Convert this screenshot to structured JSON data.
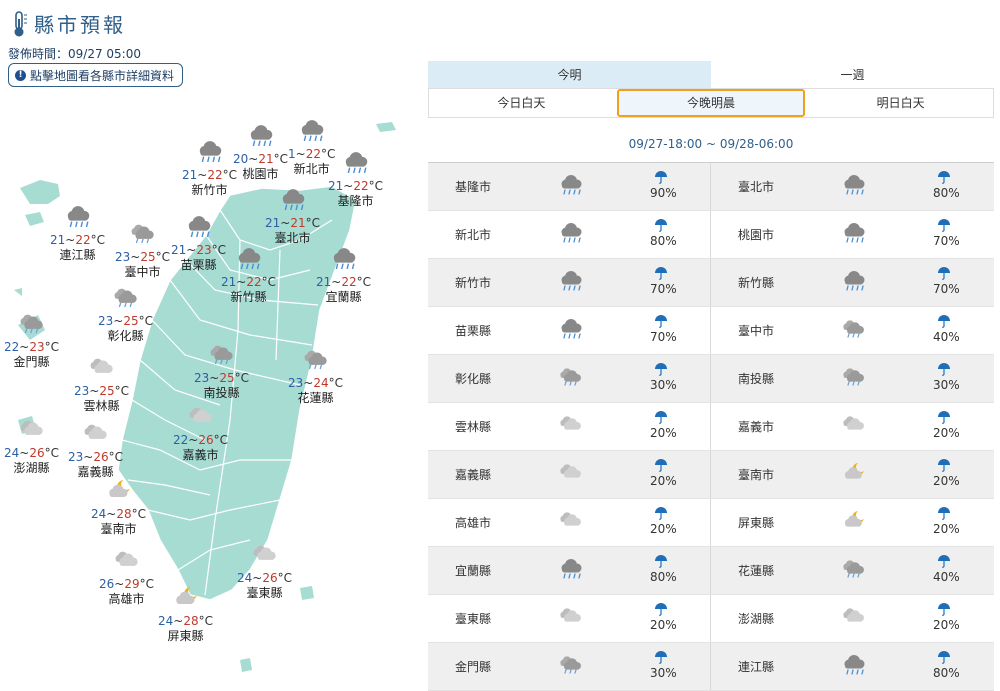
{
  "header": {
    "title": "縣市預報",
    "issue_time": "發佈時間：09/27 05:00",
    "hint_button": "點擊地圖看各縣市詳細資料",
    "hint_icon": "info-icon"
  },
  "tabs": {
    "primary": [
      "今明",
      "一週"
    ],
    "secondary": [
      "今日白天",
      "今晚明晨",
      "明日白天"
    ],
    "active_secondary": "今晚明晨"
  },
  "period": "09/27-18:00 ~ 09/28-06:00",
  "colors": {
    "title": "#2f5f8a",
    "low_temp": "#2b5fa6",
    "high_temp": "#c0392b",
    "map_land": "#a7dcd3",
    "active_tab_border": "#f0a020",
    "umbrella": "#1e6fb8"
  },
  "map_cities": [
    {
      "name": "新竹市",
      "lo": "21",
      "hi": "22",
      "icon": "rain"
    },
    {
      "name": "桃園市",
      "lo": "20",
      "hi": "21",
      "icon": "rain"
    },
    {
      "name": "新北市",
      "lo": "1",
      "hi": "22",
      "icon": "rain"
    },
    {
      "name": "基隆市",
      "lo": "21",
      "hi": "22",
      "icon": "rain"
    },
    {
      "name": "連江縣",
      "lo": "21",
      "hi": "22",
      "icon": "rain"
    },
    {
      "name": "臺中市",
      "lo": "23",
      "hi": "25",
      "icon": "cloudy-rain"
    },
    {
      "name": "苗栗縣",
      "lo": "21",
      "hi": "23",
      "icon": "rain"
    },
    {
      "name": "臺北市",
      "lo": "21",
      "hi": "21",
      "icon": "rain"
    },
    {
      "name": "新竹縣",
      "lo": "21",
      "hi": "22",
      "icon": "rain"
    },
    {
      "name": "宜蘭縣",
      "lo": "21",
      "hi": "22",
      "icon": "rain"
    },
    {
      "name": "彰化縣",
      "lo": "23",
      "hi": "25",
      "icon": "cloudy-rain"
    },
    {
      "name": "金門縣",
      "lo": "22",
      "hi": "23",
      "icon": "cloudy-rain"
    },
    {
      "name": "南投縣",
      "lo": "23",
      "hi": "25",
      "icon": "cloudy-rain"
    },
    {
      "name": "花蓮縣",
      "lo": "23",
      "hi": "24",
      "icon": "cloudy-rain"
    },
    {
      "name": "雲林縣",
      "lo": "23",
      "hi": "25",
      "icon": "cloudy"
    },
    {
      "name": "澎湖縣",
      "lo": "24",
      "hi": "26",
      "icon": "cloudy"
    },
    {
      "name": "嘉義市",
      "lo": "22",
      "hi": "26",
      "icon": "cloudy"
    },
    {
      "name": "嘉義縣",
      "lo": "23",
      "hi": "26",
      "icon": "cloudy"
    },
    {
      "name": "臺南市",
      "lo": "24",
      "hi": "28",
      "icon": "partly-cloudy-night"
    },
    {
      "name": "高雄市",
      "lo": "26",
      "hi": "29",
      "icon": "cloudy"
    },
    {
      "name": "臺東縣",
      "lo": "24",
      "hi": "26",
      "icon": "cloudy"
    },
    {
      "name": "屏東縣",
      "lo": "24",
      "hi": "28",
      "icon": "partly-cloudy-night"
    }
  ],
  "forecast_rows": [
    [
      {
        "name": "基隆市",
        "icon": "rain",
        "pop": "90%"
      },
      {
        "name": "臺北市",
        "icon": "rain",
        "pop": "80%"
      }
    ],
    [
      {
        "name": "新北市",
        "icon": "rain",
        "pop": "80%"
      },
      {
        "name": "桃園市",
        "icon": "rain",
        "pop": "70%"
      }
    ],
    [
      {
        "name": "新竹市",
        "icon": "rain",
        "pop": "70%"
      },
      {
        "name": "新竹縣",
        "icon": "rain",
        "pop": "70%"
      }
    ],
    [
      {
        "name": "苗栗縣",
        "icon": "rain",
        "pop": "70%"
      },
      {
        "name": "臺中市",
        "icon": "cloudy-rain",
        "pop": "40%"
      }
    ],
    [
      {
        "name": "彰化縣",
        "icon": "cloudy-rain",
        "pop": "30%"
      },
      {
        "name": "南投縣",
        "icon": "cloudy-rain",
        "pop": "30%"
      }
    ],
    [
      {
        "name": "雲林縣",
        "icon": "cloudy",
        "pop": "20%"
      },
      {
        "name": "嘉義市",
        "icon": "cloudy",
        "pop": "20%"
      }
    ],
    [
      {
        "name": "嘉義縣",
        "icon": "cloudy",
        "pop": "20%"
      },
      {
        "name": "臺南市",
        "icon": "partly-cloudy-night",
        "pop": "20%"
      }
    ],
    [
      {
        "name": "高雄市",
        "icon": "cloudy",
        "pop": "20%"
      },
      {
        "name": "屏東縣",
        "icon": "partly-cloudy-night",
        "pop": "20%"
      }
    ],
    [
      {
        "name": "宜蘭縣",
        "icon": "rain",
        "pop": "80%"
      },
      {
        "name": "花蓮縣",
        "icon": "cloudy-rain",
        "pop": "40%"
      }
    ],
    [
      {
        "name": "臺東縣",
        "icon": "cloudy",
        "pop": "20%"
      },
      {
        "name": "澎湖縣",
        "icon": "cloudy",
        "pop": "20%"
      }
    ],
    [
      {
        "name": "金門縣",
        "icon": "cloudy-rain",
        "pop": "30%"
      },
      {
        "name": "連江縣",
        "icon": "rain",
        "pop": "80%"
      }
    ]
  ]
}
